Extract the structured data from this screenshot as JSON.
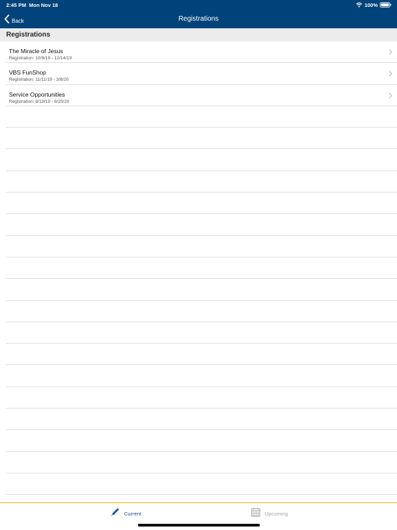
{
  "status": {
    "time": "2:45 PM",
    "date": "Mon Nov 18",
    "battery": "100%"
  },
  "nav": {
    "back_label": "Back",
    "title": "Registrations"
  },
  "section": {
    "title": "Registrations"
  },
  "items": [
    {
      "title": "The Miracle of Jesus",
      "subtitle": "Registration: 10/9/19 - 12/14/19"
    },
    {
      "title": "VBS FunShop",
      "subtitle": "Registration: 11/11/19 - 3/8/20"
    },
    {
      "title": "Service Opportunities",
      "subtitle": "Registration: 8/19/19 - 8/20/20"
    }
  ],
  "tabs": {
    "current_label": "Current",
    "upcoming_label": "Upcoming"
  },
  "colors": {
    "nav_bg": "#00427a",
    "tab_accent": "#f0b400",
    "tab_active": "#1c4f8f",
    "tab_inactive": "#a6a6a6"
  },
  "icons": {
    "back": "chevron-left-icon",
    "row_disclosure": "chevron-right-icon",
    "wifi": "wifi-icon",
    "battery": "battery-icon",
    "current_tab": "pencil-icon",
    "upcoming_tab": "calendar-icon"
  }
}
